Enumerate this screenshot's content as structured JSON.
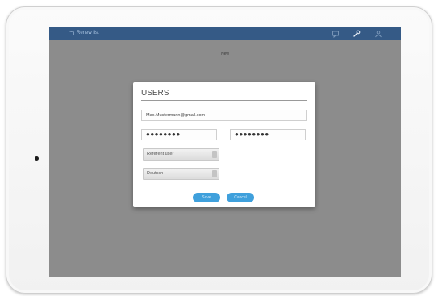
{
  "header": {
    "title": "Renew list"
  },
  "screen": {
    "subtitle": "New"
  },
  "dialog": {
    "title": "USERS",
    "email": "Max.Mustermann@gmail.com",
    "password": "●●●●●●●●",
    "password_confirm": "●●●●●●●●",
    "role_select": "Referent user",
    "language_select": "Deutsch",
    "save_label": "Save",
    "cancel_label": "Cancel"
  },
  "colors": {
    "topbar": "#355a86",
    "accent": "#3fa0dc",
    "screen_bg": "#8c8c8c"
  },
  "icons": [
    "folder-icon",
    "chat-icon",
    "wrench-icon",
    "user-icon"
  ]
}
